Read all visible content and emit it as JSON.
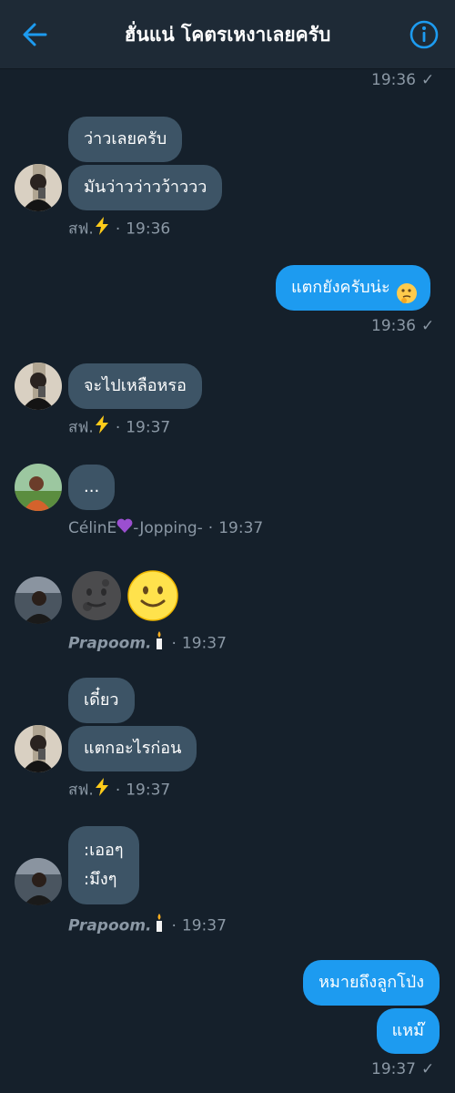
{
  "header": {
    "title": "ฮั่นแน่ โคตรเหงาเลยครับ",
    "back_icon": "arrow-left-icon",
    "info_icon": "info-circle-icon",
    "accent": "#1d9bf0"
  },
  "messages": {
    "top_time": "19:36",
    "g1": {
      "b1": "ว่าวเลยครับ",
      "b2": "มันว่าวว่าวว้าววว",
      "sender": "สฟ.",
      "time": "19:36"
    },
    "out1": {
      "text": "แตกยังครับน่ะ",
      "time": "19:36",
      "emoji": "thinking-face-icon"
    },
    "g2": {
      "b1": "จะไปเหลือหรอ",
      "sender": "สฟ.",
      "time": "19:37"
    },
    "g3": {
      "b1": "...",
      "sender_a": "CélinE",
      "sender_b": "-Jopping-",
      "time": "19:37",
      "heart": "purple-heart-icon"
    },
    "g4": {
      "emoji_1": "new-moon-face-icon",
      "emoji_2": "slightly-smiling-face-icon",
      "sender": "Prapoom.",
      "time": "19:37",
      "candle": "candle-icon"
    },
    "g5": {
      "b1": "เดี๋ยว",
      "b2": "แตกอะไรก่อน",
      "sender": "สฟ.",
      "time": "19:37"
    },
    "g6": {
      "line1": ":เออๆ",
      "line2": ":มึงๆ",
      "sender": "Prapoom.",
      "time": "19:37"
    },
    "out2": {
      "b1": "หมายถึงลูกโป่ง",
      "b2": "แหม๊",
      "time": "19:37"
    }
  },
  "colors": {
    "background": "#15202b",
    "incoming_bubble": "#3d5466",
    "outgoing_bubble": "#1d9bf0",
    "meta_text": "#8b98a5"
  }
}
